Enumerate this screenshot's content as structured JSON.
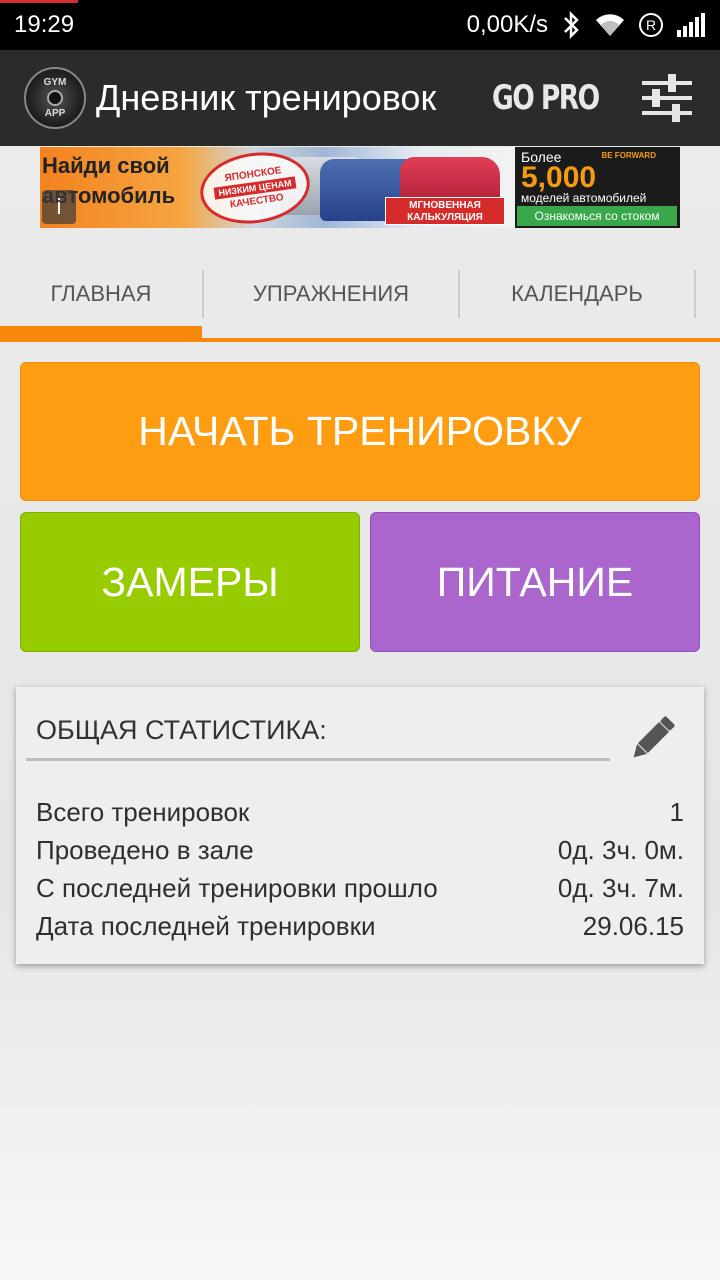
{
  "status_bar": {
    "time": "19:29",
    "net_speed": "0,00K/s",
    "icons": [
      "bluetooth-icon",
      "wifi-icon",
      "registered-icon",
      "signal-icon"
    ]
  },
  "app_bar": {
    "logo_top": "GYM",
    "logo_bottom": "APP",
    "title": "Дневник тренировок",
    "gopro_label": "GO PRO",
    "settings_icon": "sliders-icon"
  },
  "ad": {
    "headline": "Найди свой автомобиль",
    "stamp_top": "ЯПОНСКОЕ",
    "stamp_band": "НИЗКИМ ЦЕНАМ",
    "stamp_bottom": "КАЧЕСТВО",
    "calc_label": "МГНОВЕННАЯ КАЛЬКУЛЯЦИЯ",
    "more_label": "Более",
    "brand": "BE FORWARD",
    "count": "5,000",
    "models_label": "моделей автомобилей",
    "cta": "Ознакомься со стоком",
    "info_icon": "info-icon"
  },
  "tabs": [
    {
      "label": "ГЛАВНАЯ",
      "active": true
    },
    {
      "label": "УПРАЖНЕНИЯ",
      "active": false
    },
    {
      "label": "КАЛЕНДАРЬ",
      "active": false
    }
  ],
  "buttons": {
    "start_workout": "НАЧАТЬ ТРЕНИРОВКУ",
    "measurements": "ЗАМЕРЫ",
    "nutrition": "ПИТАНИЕ"
  },
  "stats": {
    "title": "ОБЩАЯ СТАТИСТИКА:",
    "edit_icon": "pencil-icon",
    "rows": [
      {
        "label": "Всего тренировок",
        "value": "1"
      },
      {
        "label": "Проведено в зале",
        "value": "0д. 3ч. 0м."
      },
      {
        "label": "С последней тренировки прошло",
        "value": "0д. 3ч. 7м."
      },
      {
        "label": "Дата последней тренировки",
        "value": "29.06.15"
      }
    ]
  },
  "colors": {
    "accent_orange": "#ff9d12",
    "green": "#96cc00",
    "purple": "#aa66cc",
    "app_bar": "#2b2b2b"
  }
}
